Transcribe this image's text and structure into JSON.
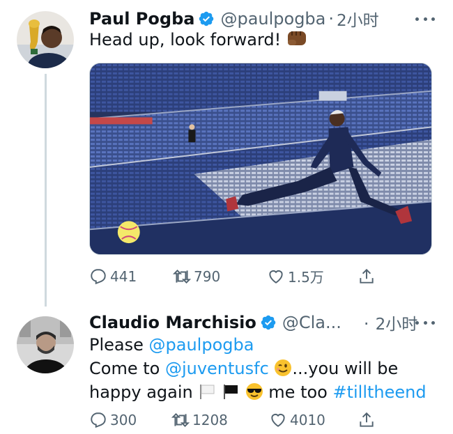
{
  "tweets": [
    {
      "author": "Paul Pogba",
      "handle": "@paulpogba",
      "separator": "·",
      "time": "2小时",
      "text": "Head up, look forward!",
      "emoji": "fist-emoji",
      "stats": {
        "replies": "441",
        "retweets": "790",
        "likes": "1.5万"
      }
    },
    {
      "author": "Claudio Marchisio",
      "handle": "@Cla...",
      "separator": "·",
      "time": "2小时",
      "lines": {
        "l1_text": "Please ",
        "l1_mention": "@paulpogba",
        "l2_text": "Come to ",
        "l2_mention": "@juventusfc",
        "l2_rest": "...you will be",
        "l3_text": "happy again",
        "l3_mid": " me too ",
        "l3_hashtag": "#tilltheend"
      },
      "stats": {
        "replies": "300",
        "retweets": "1208",
        "likes": "4010"
      }
    }
  ],
  "colors": {
    "accent": "#1d9bf0",
    "secondary_text": "#536471",
    "primary_text": "#0f1419",
    "divider": "#cfd9de"
  },
  "icons": [
    "verified-badge-icon",
    "more-options-icon",
    "reply-icon",
    "retweet-icon",
    "like-icon",
    "share-icon"
  ]
}
